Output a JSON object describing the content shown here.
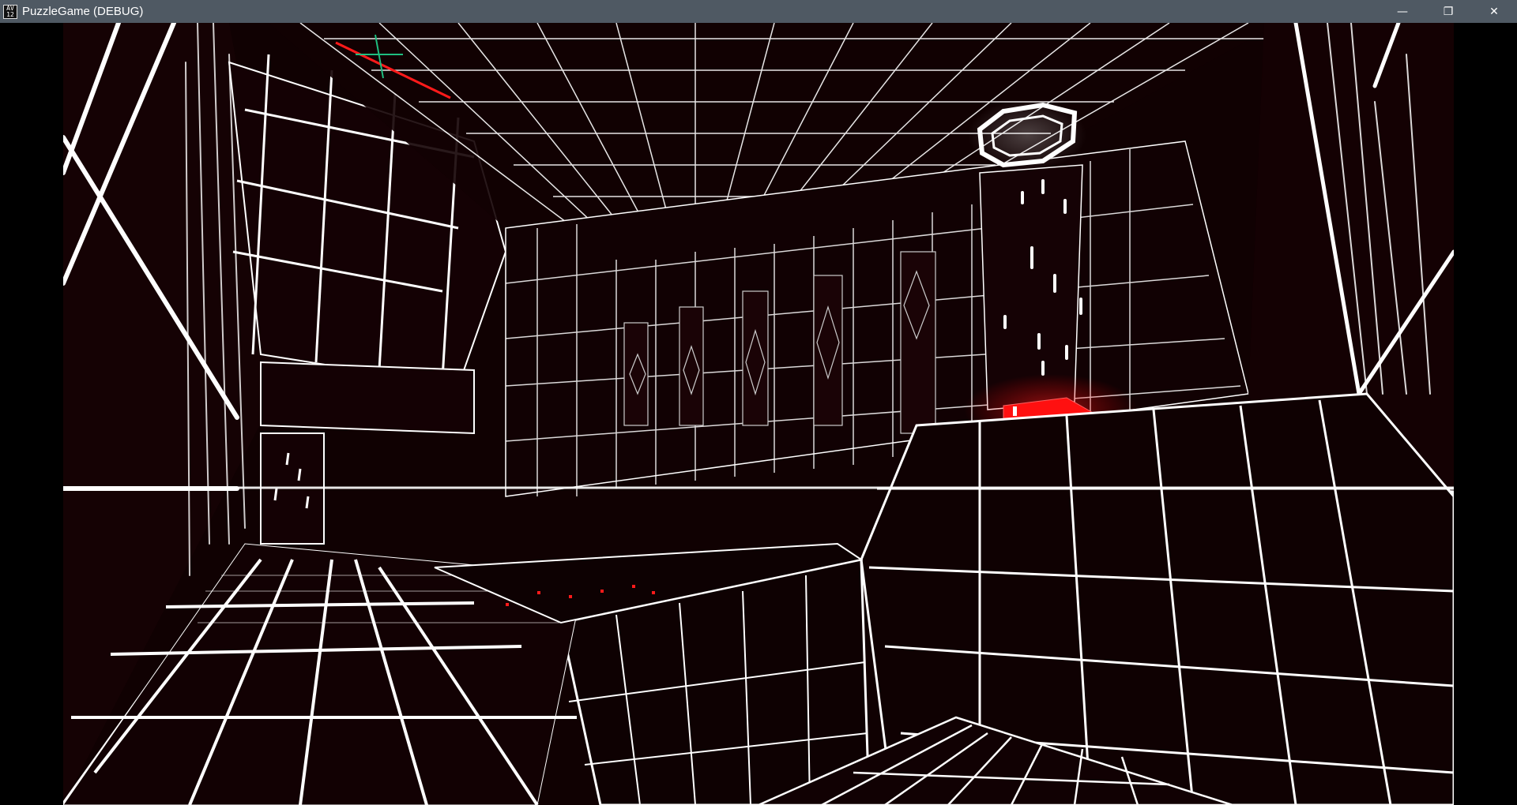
{
  "window": {
    "title": "PuzzleGame (DEBUG)",
    "icon_text": "AV\n12",
    "controls": {
      "minimize": "—",
      "restore": "❐",
      "close": "✕"
    }
  },
  "scene": {
    "background_color": "#100102",
    "grid_color": "#ffffff",
    "accent_color": "#ff1010",
    "gizmo_color": "#1fbf80"
  }
}
